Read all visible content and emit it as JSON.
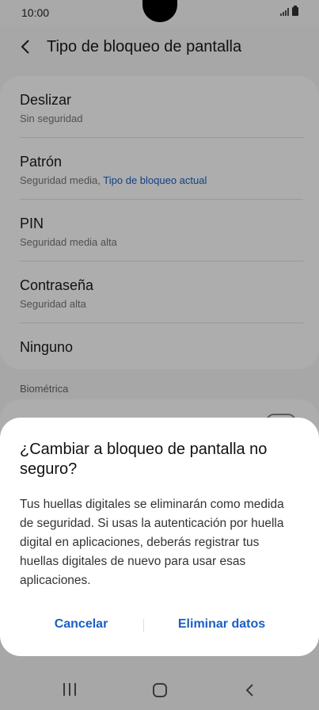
{
  "status_bar": {
    "time": "10:00"
  },
  "header": {
    "title": "Tipo de bloqueo de pantalla"
  },
  "options": [
    {
      "title": "Deslizar",
      "subtitle": "Sin seguridad"
    },
    {
      "title": "Patrón",
      "subtitle": "Seguridad media,",
      "subtitle_accent": "Tipo de bloqueo actual"
    },
    {
      "title": "PIN",
      "subtitle": "Seguridad media alta"
    },
    {
      "title": "Contraseña",
      "subtitle": "Seguridad alta"
    },
    {
      "title": "Ninguno"
    }
  ],
  "section_biometric": "Biométrica",
  "dialog": {
    "title": "¿Cambiar a bloqueo de pantalla no seguro?",
    "body": "Tus huellas digitales se eliminarán como medida de seguridad. Si usas la autenticación por huella digital en aplicaciones, deberás registrar tus huellas digitales de nuevo para usar esas aplicaciones.",
    "cancel_label": "Cancelar",
    "confirm_label": "Eliminar datos"
  },
  "colors": {
    "accent": "#1a5fc4",
    "background": "#f6f6f6",
    "dim": "rgba(0,0,0,0.32)"
  },
  "icons": {
    "back": "chevron-left-icon",
    "nav_recent": "recent-apps-icon",
    "nav_home": "home-icon",
    "nav_back": "back-arrow-icon"
  }
}
